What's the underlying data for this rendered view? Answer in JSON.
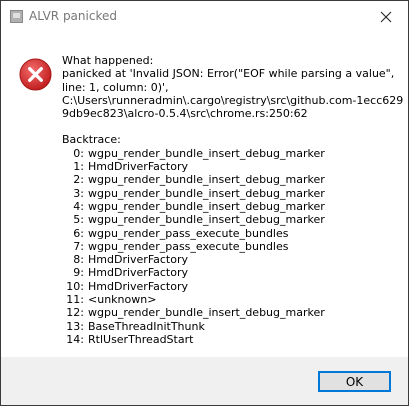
{
  "window": {
    "title": "ALVR panicked"
  },
  "message": {
    "lines": [
      "What happened:",
      "panicked at 'Invalid JSON: Error(\"EOF while parsing a value\",",
      "line: 1, column: 0)',",
      "C:\\Users\\runneradmin\\.cargo\\registry\\src\\github.com-1ecc629",
      "9db9ec823\\alcro-0.5.4\\src\\chrome.rs:250:62"
    ],
    "backtrace_heading": "Backtrace:",
    "backtrace": [
      {
        "index": "0:",
        "frame": "wgpu_render_bundle_insert_debug_marker"
      },
      {
        "index": "1:",
        "frame": "HmdDriverFactory"
      },
      {
        "index": "2:",
        "frame": "wgpu_render_bundle_insert_debug_marker"
      },
      {
        "index": "3:",
        "frame": "wgpu_render_bundle_insert_debug_marker"
      },
      {
        "index": "4:",
        "frame": "wgpu_render_bundle_insert_debug_marker"
      },
      {
        "index": "5:",
        "frame": "wgpu_render_bundle_insert_debug_marker"
      },
      {
        "index": "6:",
        "frame": "wgpu_render_pass_execute_bundles"
      },
      {
        "index": "7:",
        "frame": "wgpu_render_pass_execute_bundles"
      },
      {
        "index": "8:",
        "frame": "HmdDriverFactory"
      },
      {
        "index": "9:",
        "frame": "HmdDriverFactory"
      },
      {
        "index": "10:",
        "frame": "HmdDriverFactory"
      },
      {
        "index": "11:",
        "frame": "<unknown>"
      },
      {
        "index": "12:",
        "frame": "wgpu_render_bundle_insert_debug_marker"
      },
      {
        "index": "13:",
        "frame": "BaseThreadInitThunk"
      },
      {
        "index": "14:",
        "frame": "RtlUserThreadStart"
      }
    ]
  },
  "buttons": {
    "ok_label": "OK"
  },
  "icons": {
    "app": "app-icon",
    "error": "error-icon",
    "close": "close-icon"
  },
  "colors": {
    "error_red": "#d32f2f",
    "accent_border": "#0078d7",
    "footer_bg": "#f0f0f0"
  }
}
